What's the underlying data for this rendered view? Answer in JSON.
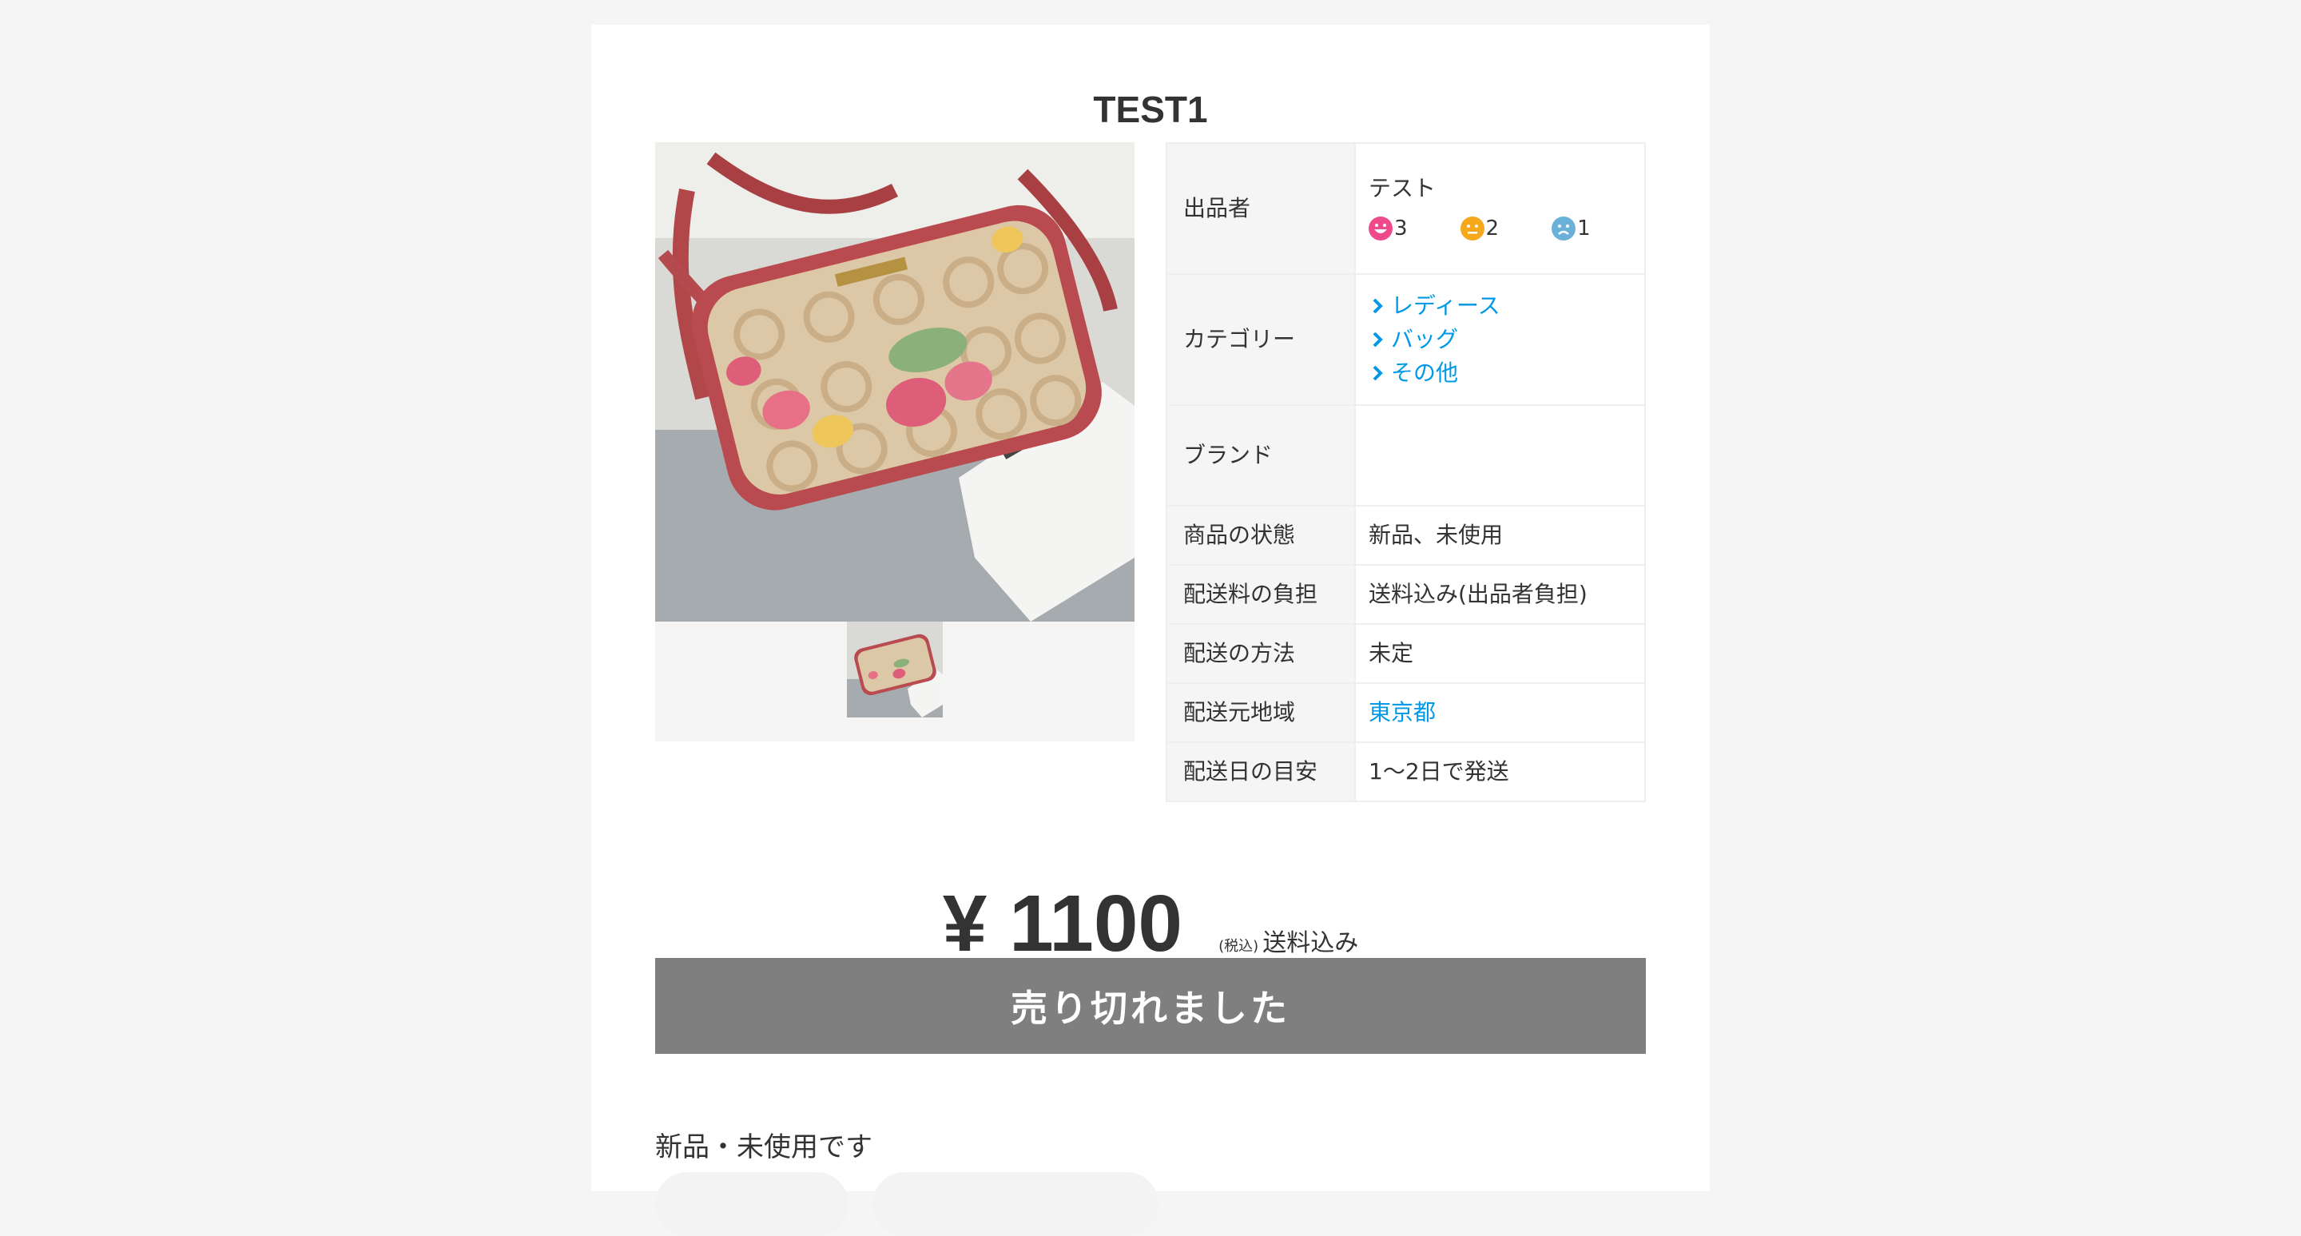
{
  "product": {
    "title": "TEST1"
  },
  "gallery": {
    "main_image_icon": "handbag-photo",
    "thumbnails": [
      "handbag-thumbnail"
    ]
  },
  "details": {
    "seller_label": "出品者",
    "seller_name": "テスト",
    "ratings": {
      "good": "3",
      "normal": "2",
      "bad": "1",
      "good_color": "#ef4b8a",
      "normal_color": "#f6a81c",
      "bad_color": "#6ab0d8"
    },
    "category_label": "カテゴリー",
    "categories": [
      "レディース",
      "バッグ",
      "その他"
    ],
    "brand_label": "ブランド",
    "brand_value": "",
    "condition_label": "商品の状態",
    "condition_value": "新品、未使用",
    "shipping_fee_label": "配送料の負担",
    "shipping_fee_value": "送料込み(出品者負担)",
    "shipping_method_label": "配送の方法",
    "shipping_method_value": "未定",
    "ship_from_label": "配送元地域",
    "ship_from_value": "東京都",
    "ship_days_label": "配送日の目安",
    "ship_days_value": "1〜2日で発送"
  },
  "price": {
    "amount": "¥ 1100",
    "tax_note": "(税込)",
    "shipping_note": "送料込み"
  },
  "purchase": {
    "sold_out_label": "売り切れました"
  },
  "description": {
    "text": "新品・未使用です"
  },
  "colors": {
    "link": "#0099e8",
    "sold_out_bg": "#7f7f7f",
    "table_header_bg": "#f5f5f5"
  }
}
